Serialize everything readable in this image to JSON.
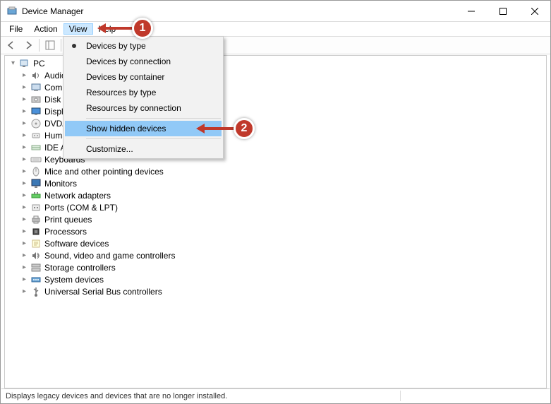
{
  "window": {
    "title": "Device Manager"
  },
  "menubar": {
    "items": [
      "File",
      "Action",
      "View",
      "Help"
    ],
    "active_index": 2
  },
  "tree": {
    "root": {
      "label": "PC",
      "expanded": true
    },
    "children": [
      {
        "label": "Audio inputs and outputs",
        "icon": "speaker"
      },
      {
        "label": "Computer",
        "icon": "computer"
      },
      {
        "label": "Disk drives",
        "icon": "disk"
      },
      {
        "label": "Display adapters",
        "icon": "display"
      },
      {
        "label": "DVD/CD-ROM drives",
        "icon": "dvd"
      },
      {
        "label": "Human Interface Devices",
        "icon": "hid"
      },
      {
        "label": "IDE ATA/ATAPI controllers",
        "icon": "ide"
      },
      {
        "label": "Keyboards",
        "icon": "keyboard"
      },
      {
        "label": "Mice and other pointing devices",
        "icon": "mouse"
      },
      {
        "label": "Monitors",
        "icon": "monitor"
      },
      {
        "label": "Network adapters",
        "icon": "network"
      },
      {
        "label": "Ports (COM & LPT)",
        "icon": "ports"
      },
      {
        "label": "Print queues",
        "icon": "printer"
      },
      {
        "label": "Processors",
        "icon": "cpu"
      },
      {
        "label": "Software devices",
        "icon": "software"
      },
      {
        "label": "Sound, video and game controllers",
        "icon": "sound"
      },
      {
        "label": "Storage controllers",
        "icon": "storage"
      },
      {
        "label": "System devices",
        "icon": "system"
      },
      {
        "label": "Universal Serial Bus controllers",
        "icon": "usb"
      }
    ]
  },
  "dropdown": {
    "items": [
      {
        "label": "Devices by type",
        "selected": true
      },
      {
        "label": "Devices by connection"
      },
      {
        "label": "Devices by container"
      },
      {
        "label": "Resources by type"
      },
      {
        "label": "Resources by connection"
      },
      {
        "sep": true
      },
      {
        "label": "Show hidden devices",
        "highlight": true
      },
      {
        "sep": true
      },
      {
        "label": "Customize..."
      }
    ]
  },
  "statusbar": {
    "text": "Displays legacy devices and devices that are no longer installed."
  },
  "annotations": {
    "marker1": "1",
    "marker2": "2"
  }
}
